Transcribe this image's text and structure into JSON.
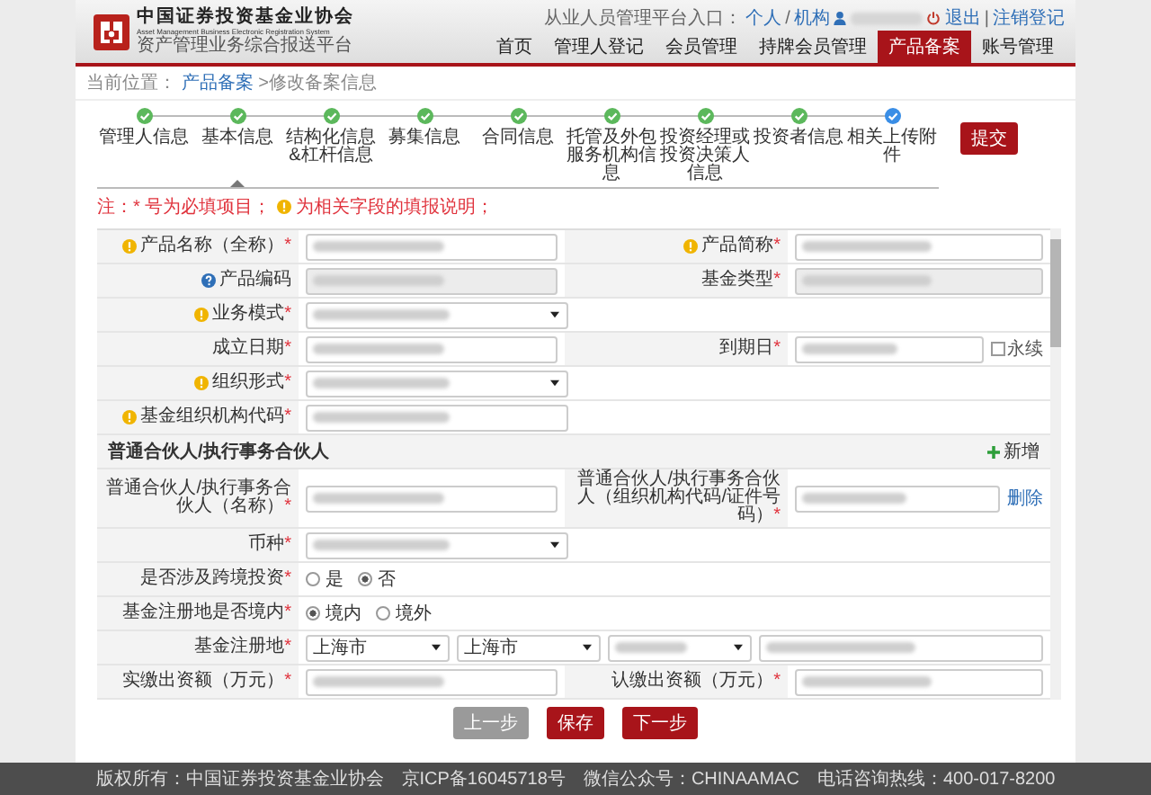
{
  "header": {
    "logo": {
      "title": "中国证券投资基金业协会",
      "subtitle_en": "Asset Management Business Electronic Registration System",
      "subtitle": "资产管理业务综合报送平台"
    },
    "entry_label": "从业人员管理平台入口：",
    "entry_links": [
      "个人",
      "机构"
    ],
    "entry_separator": "/",
    "user_blurred": true,
    "logout": "退出",
    "links_separator": "|",
    "deregister": "注销登记"
  },
  "nav": [
    {
      "label": "首页",
      "selected": false
    },
    {
      "label": "管理人登记",
      "selected": false
    },
    {
      "label": "会员管理",
      "selected": false
    },
    {
      "label": "持牌会员管理",
      "selected": false
    },
    {
      "label": "产品备案",
      "selected": true
    },
    {
      "label": "账号管理",
      "selected": false
    }
  ],
  "breadcrumb": {
    "label": "当前位置：",
    "link": "产品备案",
    "current": ">修改备案信息"
  },
  "steps": [
    {
      "label": "管理人信息",
      "kind": "done",
      "selected": false
    },
    {
      "label": "基本信息",
      "kind": "done",
      "selected": true
    },
    {
      "label": "结构化信息&杠杆信息",
      "kind": "done",
      "selected": false
    },
    {
      "label": "募集信息",
      "kind": "done",
      "selected": false
    },
    {
      "label": "合同信息",
      "kind": "done",
      "selected": false
    },
    {
      "label": "托管及外包服务机构信息",
      "kind": "done",
      "selected": false
    },
    {
      "label": "投资经理或投资决策人信息",
      "kind": "done",
      "selected": false
    },
    {
      "label": "投资者信息",
      "kind": "done",
      "selected": false
    },
    {
      "label": "相关上传附件",
      "kind": "current",
      "selected": false
    }
  ],
  "submit_button": "提交",
  "note": {
    "required": "注：* 号为必填项目；",
    "hint": "为相关字段的填报说明；"
  },
  "form": {
    "rows": [
      {
        "kind": "fields",
        "fields": [
          {
            "label": "产品名称（全称）",
            "mark": "*",
            "hint": true,
            "kind": "text",
            "blurred": true
          },
          {
            "label": "产品简称",
            "mark": "*",
            "hint": true,
            "kind": "text",
            "blurred": true
          }
        ]
      },
      {
        "kind": "fields",
        "fields": [
          {
            "label": "产品编码",
            "help": true,
            "kind": "readonly",
            "blurred": true
          },
          {
            "label": "基金类型",
            "mark": "*",
            "kind": "readonly",
            "blurred": true
          }
        ]
      },
      {
        "kind": "fields",
        "fields": [
          {
            "label": "业务模式",
            "mark": "*",
            "hint": true,
            "kind": "select",
            "blurred": true
          }
        ]
      },
      {
        "kind": "fields",
        "fields": [
          {
            "label": "成立日期",
            "mark": "*",
            "kind": "text",
            "blurred": true
          },
          {
            "label": "到期日",
            "mark": "*",
            "kind": "text",
            "blurred": true,
            "extra": {
              "kind": "checkbox",
              "label": "永续",
              "checked": false
            }
          }
        ]
      },
      {
        "kind": "fields",
        "fields": [
          {
            "label": "组织形式",
            "mark": "*",
            "hint": true,
            "kind": "select",
            "blurred": true
          }
        ]
      },
      {
        "kind": "fields",
        "fields": [
          {
            "label": "基金组织机构代码",
            "mark": "*",
            "hint": true,
            "kind": "text",
            "blurred": true
          }
        ]
      },
      {
        "kind": "section",
        "title": "普通合伙人/执行事务合伙人",
        "action": "新增"
      },
      {
        "kind": "fields",
        "fields": [
          {
            "label": "普通合伙人/执行事务合伙人（名称）",
            "mark": "*",
            "kind": "text",
            "blurred": true
          },
          {
            "label": "普通合伙人/执行事务合伙人（组织机构代码/证件号码）",
            "mark": "*",
            "kind": "text",
            "blurred": true,
            "extra": {
              "kind": "link",
              "label": "删除"
            }
          }
        ]
      },
      {
        "kind": "fields",
        "fields": [
          {
            "label": "币种",
            "mark": "*",
            "kind": "select",
            "blurred": true
          }
        ]
      },
      {
        "kind": "fields",
        "fields": [
          {
            "label": "是否涉及跨境投资",
            "mark": "*",
            "kind": "radio",
            "options": [
              {
                "label": "是",
                "selected": false
              },
              {
                "label": "否",
                "selected": true
              }
            ]
          }
        ]
      },
      {
        "kind": "fields",
        "fields": [
          {
            "label": "基金注册地是否境内",
            "mark": "*",
            "kind": "radio",
            "options": [
              {
                "label": "境内",
                "selected": true
              },
              {
                "label": "境外",
                "selected": false
              }
            ]
          }
        ]
      },
      {
        "kind": "address",
        "fields": [
          {
            "label": "基金注册地",
            "mark": "*",
            "parts": [
              {
                "kind": "select",
                "value": "上海市"
              },
              {
                "kind": "select",
                "value": "上海市"
              },
              {
                "kind": "select",
                "blurred": true
              },
              {
                "kind": "text",
                "blurred": true
              }
            ]
          }
        ]
      },
      {
        "kind": "fields",
        "fields": [
          {
            "label": "实缴出资额（万元）",
            "mark": "*",
            "kind": "text",
            "blurred": true
          },
          {
            "label": "认缴出资额（万元）",
            "mark": "*",
            "kind": "text",
            "blurred": true
          }
        ]
      }
    ]
  },
  "buttons": [
    {
      "label": "上一步",
      "disabled": true
    },
    {
      "label": "保存",
      "disabled": false
    },
    {
      "label": "下一步",
      "disabled": false
    }
  ],
  "footer": [
    "版权所有：中国证券投资基金业协会",
    "京ICP备16045718号",
    "微信公众号：CHINAAMAC",
    "电话咨询热线：400-017-8200"
  ]
}
